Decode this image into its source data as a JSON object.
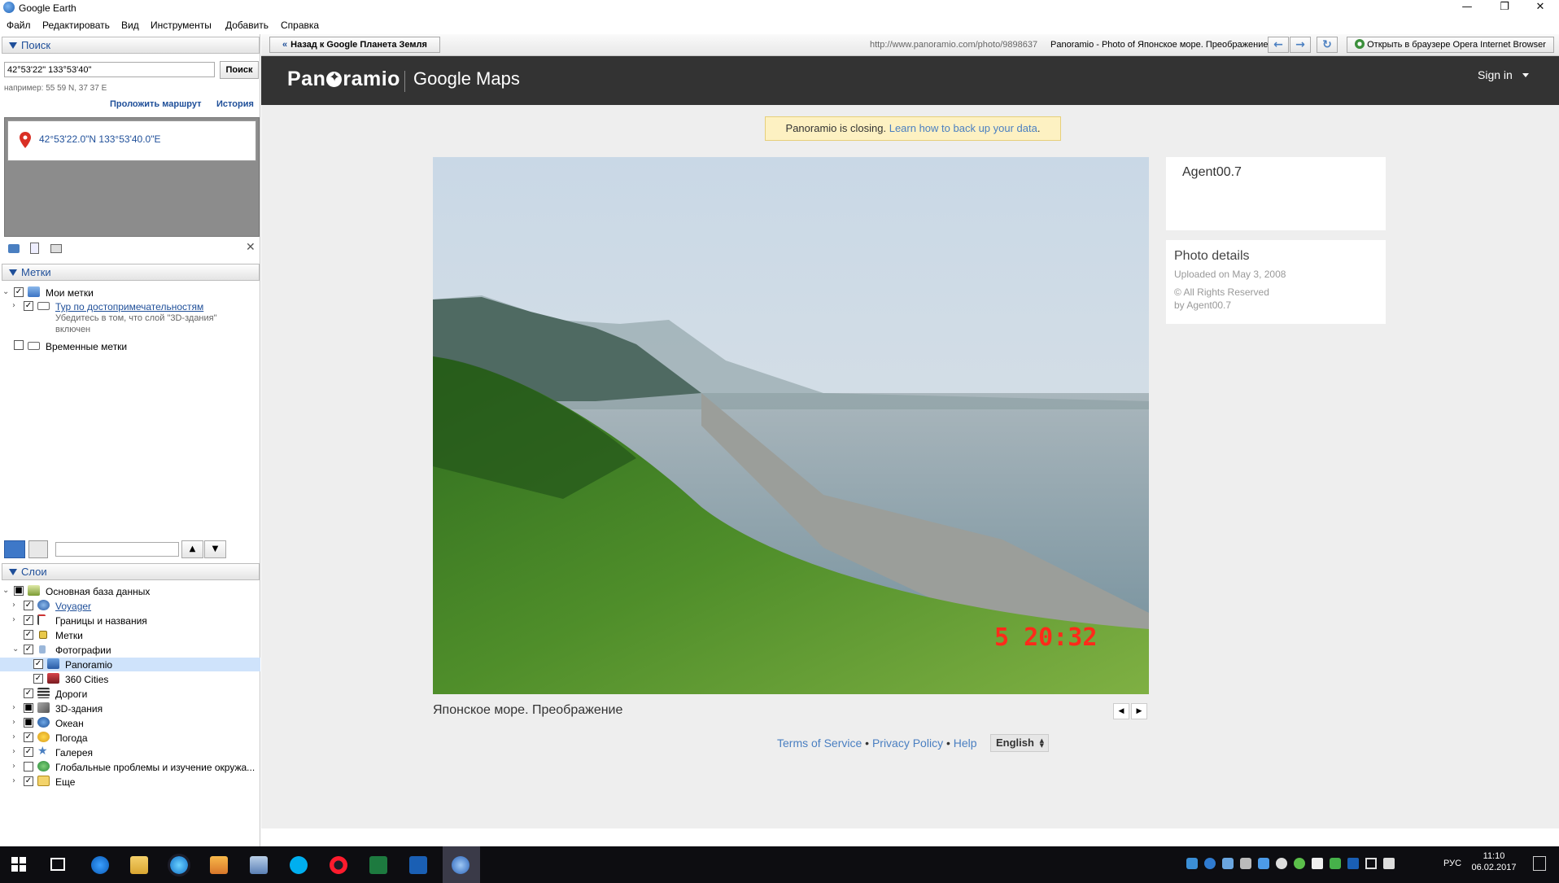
{
  "window": {
    "title": "Google Earth",
    "minimize": "—",
    "maximize": "❐",
    "close": "✕"
  },
  "menu": [
    "Файл",
    "Редактировать",
    "Вид",
    "Инструменты",
    "Добавить",
    "Справка"
  ],
  "search": {
    "header": "Поиск",
    "query": "42°53'22\" 133°53'40\"",
    "button": "Поиск",
    "example": "например: 55 59 N, 37 37 E",
    "route_link": "Проложить маршрут",
    "history_link": "История",
    "result": "42°53'22.0\"N 133°53'40.0\"E"
  },
  "places": {
    "header": "Метки",
    "items": [
      {
        "label": "Мои метки",
        "checked": true
      },
      {
        "label": "Тур по достопримечательностям",
        "checked": true,
        "note": "Убедитесь в том, что слой \"3D-здания\" включен"
      },
      {
        "label": "Временные метки",
        "checked": false
      }
    ]
  },
  "layers": {
    "header": "Слои",
    "items": [
      {
        "label": "Основная база данных"
      },
      {
        "label": "Voyager"
      },
      {
        "label": "Границы и названия"
      },
      {
        "label": "Метки"
      },
      {
        "label": "Фотографии"
      },
      {
        "label": "Panoramio"
      },
      {
        "label": "360 Cities"
      },
      {
        "label": "Дороги"
      },
      {
        "label": "3D-здания"
      },
      {
        "label": "Океан"
      },
      {
        "label": "Погода"
      },
      {
        "label": "Галерея"
      },
      {
        "label": "Глобальные проблемы и изучение окружа..."
      },
      {
        "label": "Еще"
      }
    ]
  },
  "browser": {
    "back_button": "Назад к Google Планета Земля",
    "url": "http://www.panoramio.com/photo/9898637",
    "page_title": "Panoramio - Photo of Японское море. Преображение",
    "open_in_browser": "Открыть в браузере Opera Internet Browser"
  },
  "panoramio": {
    "logo_left": "Pan",
    "logo_right": "ramio",
    "google_maps": "Google Maps",
    "sign_in": "Sign in",
    "notice_text": "Panoramio is closing.",
    "notice_link": "Learn how to back up your data",
    "notice_end": ".",
    "photo_title": "Японское море. Преображение",
    "photo_stamp": "5  20:32",
    "author": "Agent00.7",
    "details_title": "Photo details",
    "uploaded": "Uploaded on May 3, 2008",
    "rights": "© All Rights Reserved",
    "by": "by Agent00.7",
    "footer_terms": "Terms of Service",
    "footer_privacy": "Privacy Policy",
    "footer_help": "Help",
    "language": "English",
    "bullet": "•"
  },
  "taskbar": {
    "lang": "РУС",
    "time": "11:10",
    "date": "06.02.2017"
  },
  "colors": {
    "accent": "#1f4f99",
    "pano_header": "#333333",
    "link": "#4a7fc1",
    "notice_bg": "#fdf1c2",
    "stamp": "#ff2a1a"
  }
}
